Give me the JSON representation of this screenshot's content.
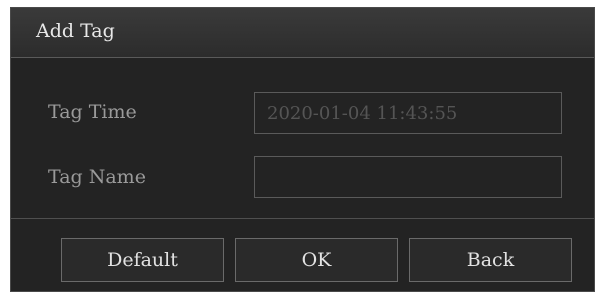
{
  "dialog": {
    "title": "Add Tag"
  },
  "form": {
    "tag_time_label": "Tag Time",
    "tag_time_value": "2020-01-04 11:43:55",
    "tag_name_label": "Tag Name",
    "tag_name_value": ""
  },
  "buttons": {
    "default_label": "Default",
    "ok_label": "OK",
    "back_label": "Back"
  }
}
